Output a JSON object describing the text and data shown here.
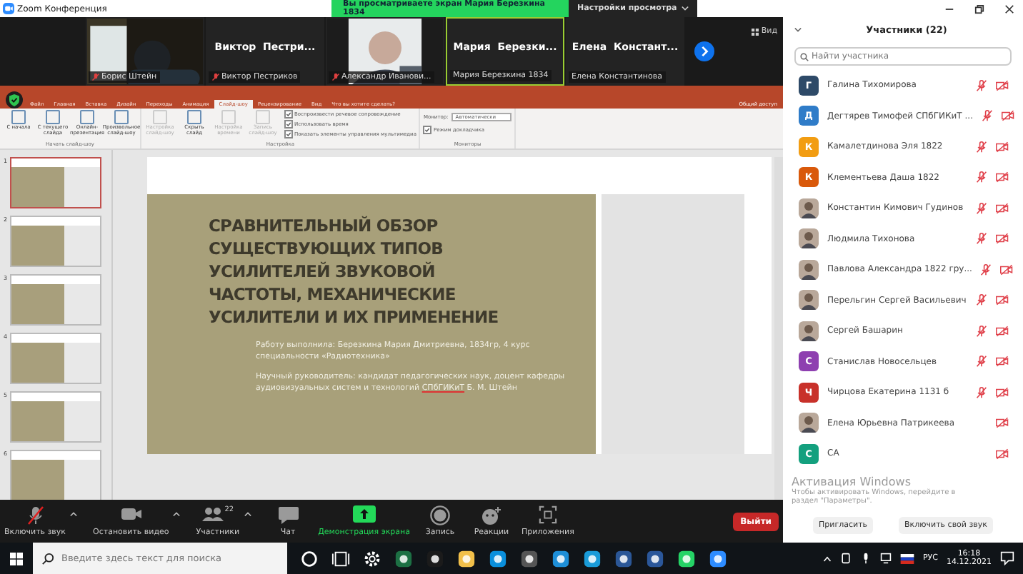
{
  "window": {
    "title": "Zoom Конференция"
  },
  "banner": {
    "text": "Вы просматриваете экран Мария Березкина 1834",
    "view_options": "Настройки просмотра"
  },
  "gallery": {
    "view_label": "Вид",
    "tiles": [
      {
        "kind": "video",
        "label": "Борис Штейн",
        "muted": true,
        "speaking": false
      },
      {
        "kind": "name",
        "display": "Виктор  Пестри...",
        "label": "Виктор Пестриков",
        "muted": true,
        "speaking": false
      },
      {
        "kind": "video",
        "label": "Александр Иванови...",
        "muted": true,
        "speaking": false
      },
      {
        "kind": "name",
        "display": "Мария  Березки...",
        "label": "Мария Березкина 1834",
        "muted": false,
        "speaking": true
      },
      {
        "kind": "name",
        "display": "Елена  Констант...",
        "label": "Елена Константинова",
        "muted": false,
        "speaking": false
      }
    ]
  },
  "powerpoint": {
    "tabs": [
      {
        "label": "Файл",
        "selected": false
      },
      {
        "label": "Главная",
        "selected": false
      },
      {
        "label": "Вставка",
        "selected": false
      },
      {
        "label": "Дизайн",
        "selected": false
      },
      {
        "label": "Переходы",
        "selected": false
      },
      {
        "label": "Анимация",
        "selected": false
      },
      {
        "label": "Слайд-шоу",
        "selected": true
      },
      {
        "label": "Рецензирование",
        "selected": false
      },
      {
        "label": "Вид",
        "selected": false
      }
    ],
    "tell_me": "Что вы хотите сделать?",
    "share": "Общий доступ",
    "ribbon_buttons": [
      {
        "label": "С начала",
        "disabled": false
      },
      {
        "label": "С текущего слайда",
        "disabled": false
      },
      {
        "label": "Онлайн-презентация",
        "disabled": false
      },
      {
        "label": "Произвольное слайд-шоу",
        "disabled": false
      },
      {
        "label": "Настройка слайд-шоу",
        "disabled": true
      },
      {
        "label": "Скрыть слайд",
        "disabled": false
      },
      {
        "label": "Настройка времени",
        "disabled": true
      },
      {
        "label": "Запись слайд-шоу",
        "disabled": true
      }
    ],
    "options": [
      {
        "label": "Воспроизвести речевое сопровождение",
        "checked": true
      },
      {
        "label": "Использовать время",
        "checked": true
      },
      {
        "label": "Показать элементы управления мультимедиа",
        "checked": true
      }
    ],
    "monitor_label": "Монитор:",
    "monitor_value": "Автоматически",
    "presenter_view": {
      "label": "Режим докладчика",
      "checked": true
    },
    "groups": [
      "Начать слайд-шоу",
      "Настройка",
      "Мониторы"
    ],
    "thumbnails": [
      {
        "number": "1",
        "selected": true
      },
      {
        "number": "2",
        "selected": false
      },
      {
        "number": "3",
        "selected": false
      },
      {
        "number": "4",
        "selected": false
      },
      {
        "number": "5",
        "selected": false
      },
      {
        "number": "6",
        "selected": false
      }
    ],
    "slide": {
      "title": "СРАВНИТЕЛЬНЫЙ ОБЗОР СУЩЕСТВУЮЩИХ ТИПОВ УСИЛИТЕЛЕЙ ЗВУКОВОЙ ЧАСТОТЫ, МЕХАНИЧЕСКИЕ УСИЛИТЕЛИ И ИХ ПРИМЕНЕНИЕ",
      "author": "Работу выполнила: Березкина Мария Дмитриевна, 1834гр, 4 курс специальности «Радиотехника»",
      "supervisor": "Научный руководитель: кандидат педагогических наук, доцент кафедры аудиовизуальных систем и технологий",
      "supervisor_org": "СПбГИКиТ",
      "supervisor_name": "Б. М. Штейн"
    }
  },
  "toolbar": {
    "items": [
      {
        "kind": "mic",
        "label": "Включить звук",
        "caret": true,
        "active": false
      },
      {
        "kind": "video",
        "label": "Остановить видео",
        "caret": true,
        "active": false
      },
      {
        "kind": "participants",
        "label": "Участники",
        "count": "22",
        "caret": true,
        "active": false
      },
      {
        "kind": "chat",
        "label": "Чат",
        "caret": false,
        "active": false
      },
      {
        "kind": "share",
        "label": "Демонстрация экрана",
        "caret": false,
        "active": true
      },
      {
        "kind": "record",
        "label": "Запись",
        "caret": false,
        "active": false
      },
      {
        "kind": "reactions",
        "label": "Реакции",
        "caret": false,
        "active": false
      },
      {
        "kind": "apps",
        "label": "Приложения",
        "caret": false,
        "active": false
      }
    ],
    "leave": "Выйти"
  },
  "participants": {
    "title": "Участники (22)",
    "search_placeholder": "Найти участника",
    "items": [
      {
        "name": "Галина Тихомирова",
        "kind": "letter",
        "letter": "Г",
        "color": "#2e4a68",
        "mic_muted": true,
        "video_off": true
      },
      {
        "name": "Дегтярев Тимофей СПбГИКиТ ...",
        "kind": "letter",
        "letter": "Д",
        "color": "#2f7cc8",
        "mic_muted": true,
        "video_off": true
      },
      {
        "name": "Камалетдинова Эля 1822",
        "kind": "letter",
        "letter": "К",
        "color": "#f29d12",
        "mic_muted": true,
        "video_off": true
      },
      {
        "name": "Клементьева Даша 1822",
        "kind": "letter",
        "letter": "К",
        "color": "#d9590b",
        "mic_muted": true,
        "video_off": true
      },
      {
        "name": "Константин Кимович Гудинов",
        "mic_muted": true,
        "video_off": true
      },
      {
        "name": "Людмила Тихонова",
        "mic_muted": true,
        "video_off": true
      },
      {
        "name": "Павлова Александра 1822 гру...",
        "mic_muted": true,
        "video_off": true
      },
      {
        "name": "Перельгин Сергей Васильевич",
        "mic_muted": true,
        "video_off": true
      },
      {
        "name": "Сергей Башарин",
        "mic_muted": true,
        "video_off": true
      },
      {
        "name": "Станислав Новосельцев",
        "kind": "letter",
        "letter": "С",
        "color": "#8e3fb0",
        "mic_muted": true,
        "video_off": true
      },
      {
        "name": "Чирцова Екатерина 1131 б",
        "kind": "letter",
        "letter": "Ч",
        "color": "#c8312a",
        "mic_muted": true,
        "video_off": true
      },
      {
        "name": "Елена Юрьевна Патрикеева",
        "mic_muted": false,
        "video_off": true
      },
      {
        "name": "СА",
        "kind": "letter",
        "letter": "С",
        "color": "#13a07e",
        "mic_muted": false,
        "video_off": true
      }
    ],
    "invite": "Пригласить",
    "unmute_self": "Включить свой звук"
  },
  "activation": {
    "title": "Активация Windows",
    "line1": "Чтобы активировать Windows, перейдите в",
    "line2": "раздел \"Параметры\"."
  },
  "taskbar": {
    "search_placeholder": "Введите здесь текст для поиска",
    "language": "РУС",
    "time": "16:18",
    "date": "14.12.2021"
  }
}
